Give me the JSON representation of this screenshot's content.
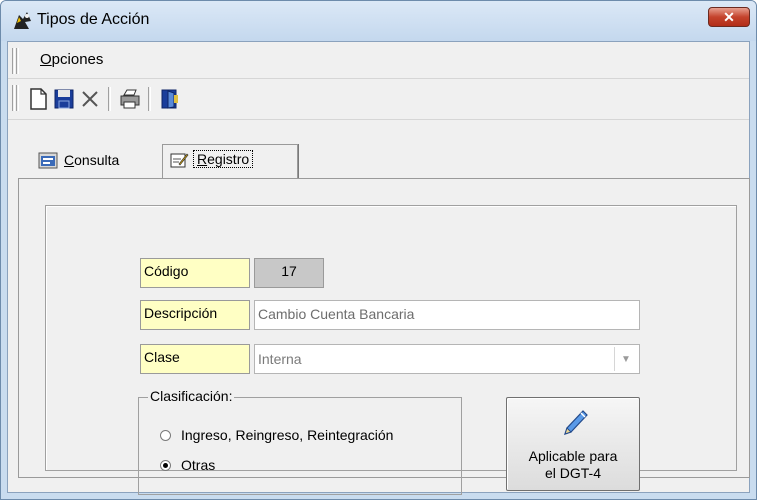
{
  "window": {
    "title": "Tipos de Acción",
    "close_label": "✕"
  },
  "menu": {
    "opciones_first": "O",
    "opciones_rest": "pciones"
  },
  "toolbar": {
    "icons": [
      "new-document-icon",
      "save-icon",
      "delete-icon",
      "print-icon",
      "exit-icon"
    ]
  },
  "tabs": {
    "consulta_first": "C",
    "consulta_rest": "onsulta",
    "registro_first": "R",
    "registro_rest": "egistro",
    "active": "registro"
  },
  "form": {
    "codigo_label": "Código",
    "codigo_value": "17",
    "descripcion_label": "Descripción",
    "descripcion_value": "Cambio Cuenta Bancaria",
    "clase_label": "Clase",
    "clase_value": "Interna",
    "clasificacion_legend": "Clasificación:",
    "radio_1": "Ingreso, Reingreso, Reintegración",
    "radio_2": "Otras",
    "selected_radio": "Otras",
    "dgt_line1": "Aplicable para",
    "dgt_line2": "el DGT-4"
  },
  "colors": {
    "label_bg": "#ffffc4",
    "codigo_bg": "#c8c8c8",
    "title_bg": "#c4d8ee"
  }
}
